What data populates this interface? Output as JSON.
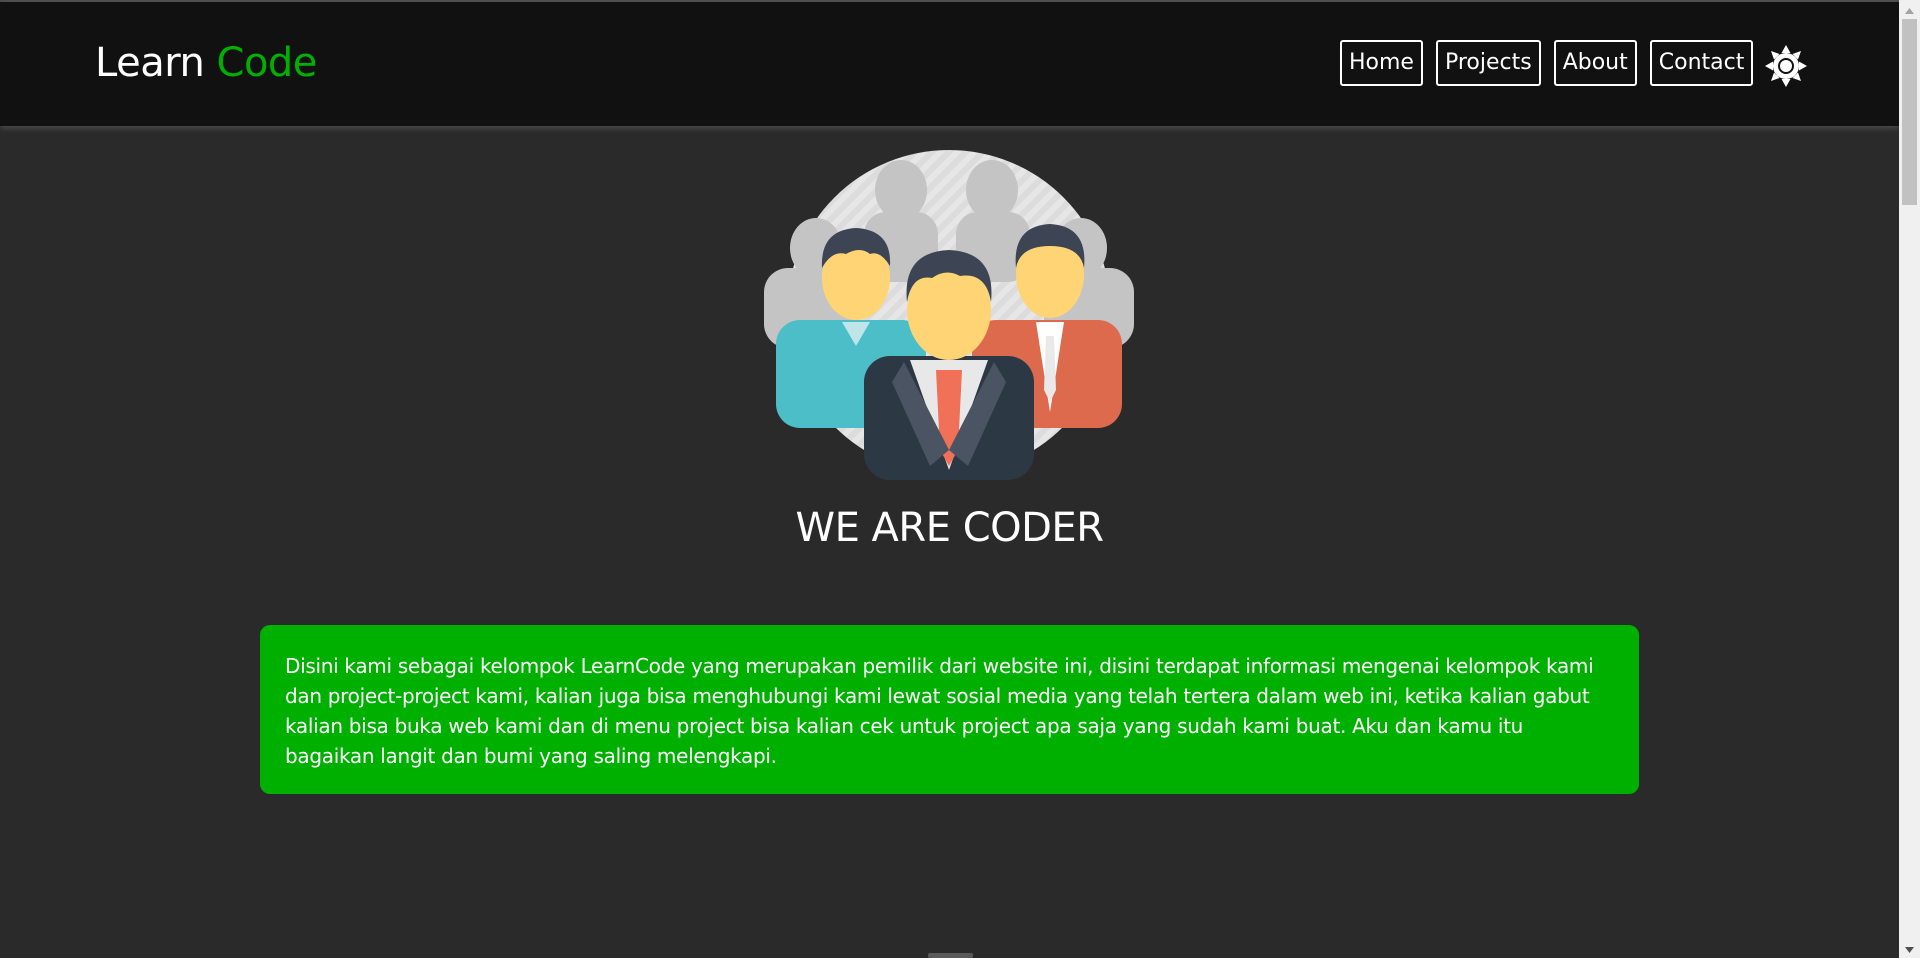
{
  "brand": {
    "first": "Learn",
    "second": "Code"
  },
  "nav": {
    "items": [
      {
        "label": "Home"
      },
      {
        "label": "Projects"
      },
      {
        "label": "About"
      },
      {
        "label": "Contact"
      }
    ],
    "theme_toggle_icon": "sun-icon"
  },
  "hero": {
    "image_icon": "team-people-illustration",
    "title": "WE ARE CODER"
  },
  "about": {
    "text": "Disini kami sebagai kelompok LearnCode yang merupakan pemilik dari website ini, disini terdapat informasi mengenai kelompok kami dan project-project kami, kalian juga bisa menghubungi kami lewat sosial media yang telah tertera dalam web ini, ketika kalian gabut kalian bisa buka web kami dan di menu project bisa kalian cek untuk project apa saja yang sudah kami buat. Aku dan kamu itu bagaikan langit dan bumi yang saling melengkapi."
  },
  "colors": {
    "accent": "#00b000",
    "background": "#2a2a2a",
    "navbar": "#111111",
    "text": "#ffffff"
  }
}
